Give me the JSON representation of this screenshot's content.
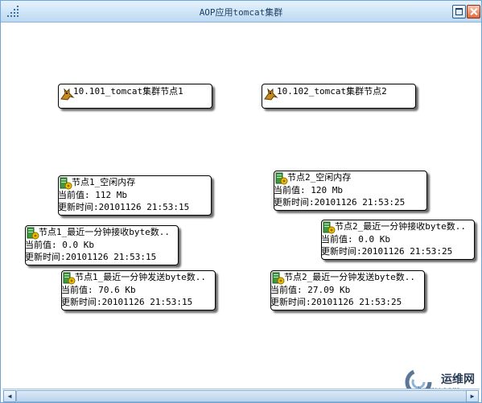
{
  "window": {
    "title": "AOP应用tomcat集群"
  },
  "colors": {
    "title_bar": "#bcd9f2",
    "accent": "#2a5c8c",
    "node_border": "#000000",
    "close_button": "#e06a3e"
  },
  "icons": {
    "node": "tomcat-cat-icon",
    "monitor": "monitor-db-icon"
  },
  "nodes": [
    {
      "label": "10.101_tomcat集群节点1"
    },
    {
      "label": "10.102_tomcat集群节点2"
    }
  ],
  "monitors": [
    {
      "title": "节点1_空闲内存",
      "value_line": "当前值:  112 Mb",
      "time_line": "更新时间:20101126 21:53:15"
    },
    {
      "title": "节点2_空闲内存",
      "value_line": "当前值:  120 Mb",
      "time_line": "更新时间:20101126 21:53:25"
    },
    {
      "title": "节点1_最近一分钟接收byte数..",
      "value_line": "当前值:  0.0 Kb",
      "time_line": "更新时间:20101126 21:53:15"
    },
    {
      "title": "节点2_最近一分钟接收byte数..",
      "value_line": "当前值:  0.0 Kb",
      "time_line": "更新时间:20101126 21:53:25"
    },
    {
      "title": "节点1_最近一分钟发送byte数..",
      "value_line": "当前值:  70.6 Kb",
      "time_line": "更新时间:20101126 21:53:15"
    },
    {
      "title": "节点2_最近一分钟发送byte数..",
      "value_line": "当前值:  27.09 Kb",
      "time_line": "更新时间:20101126 21:53:25"
    }
  ],
  "scrollbar": {
    "left_arrow": "◀",
    "right_arrow": "▶"
  },
  "watermark": {
    "name": "运维网",
    "url": "iyunv.com"
  }
}
